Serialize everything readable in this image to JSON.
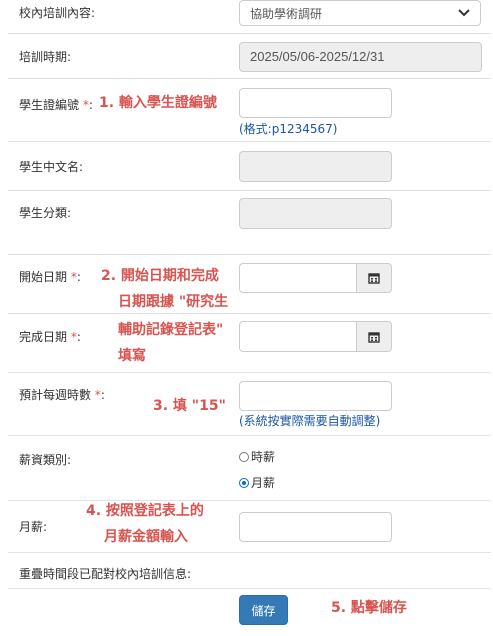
{
  "fields": {
    "training_content": {
      "label": "校內培訓內容:",
      "value": "協助學術調研"
    },
    "training_period": {
      "label": "培訓時期:",
      "value": "2025/05/06-2025/12/31"
    },
    "student_id": {
      "label": "學生證編號",
      "required": "*",
      "suffix": ":",
      "value": "",
      "help": "(格式:p1234567)"
    },
    "chinese_name": {
      "label": "學生中文名:",
      "value": ""
    },
    "classification": {
      "label": "學生分類:",
      "value": ""
    },
    "start_date": {
      "label": "開始日期",
      "required": "*",
      "suffix": ":",
      "value": ""
    },
    "end_date": {
      "label": "完成日期",
      "required": "*",
      "suffix": ":",
      "value": ""
    },
    "weekly_hours": {
      "label": "預計每週時數",
      "required": "*",
      "suffix": ":",
      "value": "",
      "help": "(系統按實際需要自動調整)"
    },
    "salary_type": {
      "label": "薪資類別:",
      "options": [
        "時薪",
        "月薪"
      ],
      "selected": "月薪"
    },
    "monthly_salary": {
      "label": "月薪:",
      "value": ""
    },
    "overlap_info": {
      "label": "重疊時間段已配對校內培訓信息:"
    }
  },
  "save_button": "儲存",
  "annotations": {
    "a1": "1. 輸入學生證編號",
    "a2_l1": "2. 開始日期和完成",
    "a2_l2": "日期跟據 \"研究生",
    "a2_l3": "輔助記錄登記表\"",
    "a2_l4": "填寫",
    "a3": "3. 填 \"15\"",
    "a4_l1": "4. 按照登記表上的",
    "a4_l2": "月薪金額輸入",
    "a5": "5. 點擊儲存"
  },
  "colors": {
    "annotation": "#d9534f",
    "help": "#1a56a8",
    "primary_button": "#337ab7"
  }
}
